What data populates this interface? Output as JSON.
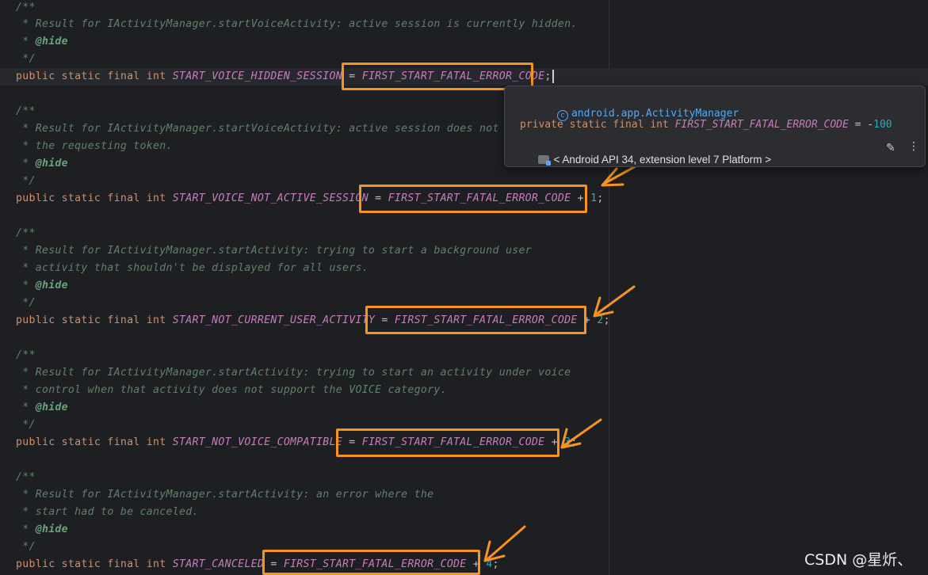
{
  "code": {
    "block1": {
      "doc_open": "/**",
      "doc_line1": " * Result for IActivityManager.startVoiceActivity: active session is currently hidden.",
      "doc_hide_prefix": " * ",
      "hide_tag": "@hide",
      "doc_close": " */",
      "decl_prefix": "public static final int ",
      "name": "START_VOICE_HIDDEN_SESSION",
      "eq": " = ",
      "ref": "FIRST_START_FATAL_ERROR_CODE",
      "semicolon": ";"
    },
    "block2": {
      "doc_open": "/**",
      "doc_line1": " * Result for IActivityManager.startVoiceActivity: active session does not matc",
      "doc_line2": " * the requesting token.",
      "doc_hide_prefix": " * ",
      "hide_tag": "@hide",
      "doc_close": " */",
      "decl_prefix": "public static final int ",
      "name": "START_VOICE_NOT_ACTIVE_SESSION",
      "eq": " = ",
      "ref": "FIRST_START_FATAL_ERROR_CODE",
      "plus": " + ",
      "value": "1",
      "semicolon": ";"
    },
    "block3": {
      "doc_open": "/**",
      "doc_line1": " * Result for IActivityManager.startActivity: trying to start a background user",
      "doc_line2": " * activity that shouldn't be displayed for all users.",
      "doc_hide_prefix": " * ",
      "hide_tag": "@hide",
      "doc_close": " */",
      "decl_prefix": "public static final int ",
      "name": "START_NOT_CURRENT_USER_ACTIVITY",
      "eq": " = ",
      "ref": "FIRST_START_FATAL_ERROR_CODE",
      "plus": " + ",
      "value": "2",
      "semicolon": ";"
    },
    "block4": {
      "doc_open": "/**",
      "doc_line1": " * Result for IActivityManager.startActivity: trying to start an activity under voice",
      "doc_line2": " * control when that activity does not support the VOICE category.",
      "doc_hide_prefix": " * ",
      "hide_tag": "@hide",
      "doc_close": " */",
      "decl_prefix": "public static final int ",
      "name": "START_NOT_VOICE_COMPATIBLE",
      "eq": " = ",
      "ref": "FIRST_START_FATAL_ERROR_CODE",
      "plus": " + ",
      "value": "3",
      "semicolon": ";"
    },
    "block5": {
      "doc_open": "/**",
      "doc_line1": " * Result for IActivityManager.startActivity: an error where the",
      "doc_line2": " * start had to be canceled.",
      "doc_hide_prefix": " * ",
      "hide_tag": "@hide",
      "doc_close": " */",
      "decl_prefix": "public static final int ",
      "name": "START_CANCELED",
      "eq": " = ",
      "ref": "FIRST_START_FATAL_ERROR_CODE",
      "plus": " + ",
      "value": "4",
      "semicolon": ";"
    }
  },
  "popup": {
    "class_icon": "c-class-icon",
    "class_name": "android.app.ActivityManager",
    "decl_keywords": "private static final int ",
    "decl_name": "FIRST_START_FATAL_ERROR_CODE",
    "decl_eq": " = -",
    "decl_value": "100",
    "api_icon": "folder-module-icon",
    "api_text": "< Android API 34, extension level 7 Platform >",
    "edit_icon": "pencil-icon",
    "more_icon": "more-vertical-icon"
  },
  "colors": {
    "background": "#1e1f22",
    "highlight_border": "#f7931e",
    "keyword": "#cf8e6d",
    "constant": "#c77dbb",
    "comment": "#5f826b",
    "number": "#2aacb8",
    "link": "#56a8f5"
  },
  "watermark": "CSDN @星炘、"
}
